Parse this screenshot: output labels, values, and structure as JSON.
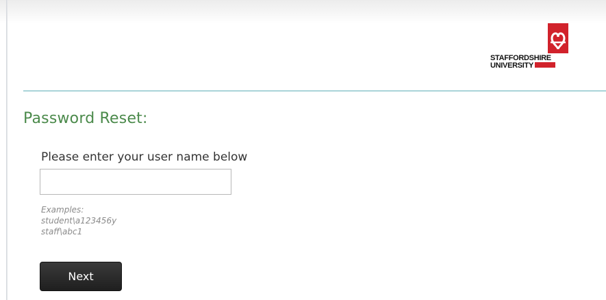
{
  "header": {
    "logo": {
      "line1": "STAFFORDSHIRE",
      "line2": "UNIVERSITY",
      "brand_color": "#d1222b"
    },
    "divider_color": "#a9d3d8"
  },
  "page": {
    "title": "Password Reset:",
    "title_color": "#4b8a4b"
  },
  "form": {
    "prompt": "Please enter your user name below",
    "username_value": "",
    "examples_label": "Examples:",
    "examples": [
      "student\\a123456y",
      "staff\\abc1"
    ],
    "next_label": "Next"
  }
}
